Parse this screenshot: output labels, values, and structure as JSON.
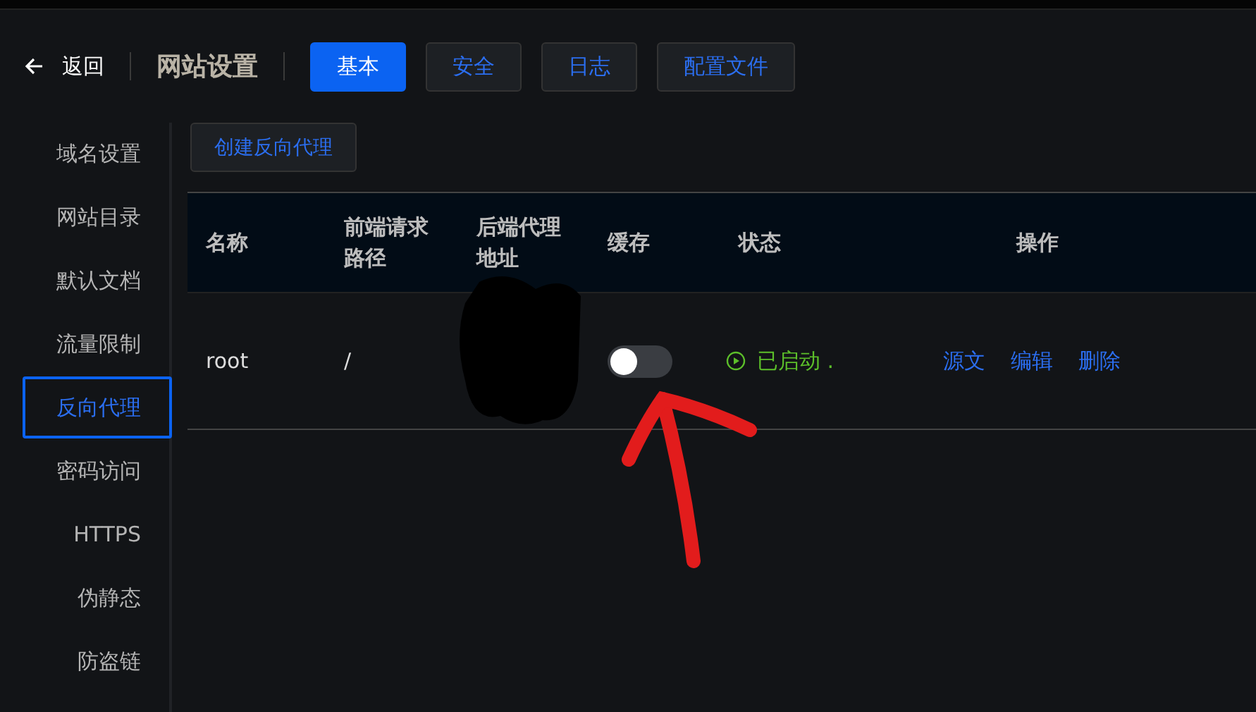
{
  "header": {
    "back": "返回",
    "title": "网站设置",
    "tabs": [
      {
        "label": "基本",
        "selected": true
      },
      {
        "label": "安全",
        "selected": false
      },
      {
        "label": "日志",
        "selected": false
      },
      {
        "label": "配置文件",
        "selected": false
      }
    ]
  },
  "sidebar": {
    "items": [
      {
        "label": "域名设置",
        "selected": false
      },
      {
        "label": "网站目录",
        "selected": false
      },
      {
        "label": "默认文档",
        "selected": false
      },
      {
        "label": "流量限制",
        "selected": false
      },
      {
        "label": "反向代理",
        "selected": true
      },
      {
        "label": "密码访问",
        "selected": false
      },
      {
        "label": "HTTPS",
        "selected": false
      },
      {
        "label": "伪静态",
        "selected": false
      },
      {
        "label": "防盗链",
        "selected": false
      }
    ]
  },
  "create_button": "创建反向代理",
  "table": {
    "columns": [
      "名称",
      "前端请求路径",
      "后端代理地址",
      "缓存",
      "状态",
      "操作"
    ],
    "rows": [
      {
        "name": "root",
        "path": "/",
        "cache": {
          "on": false
        },
        "status": "已启动 .",
        "actions": [
          "源文",
          "编辑",
          "删除"
        ]
      }
    ]
  }
}
